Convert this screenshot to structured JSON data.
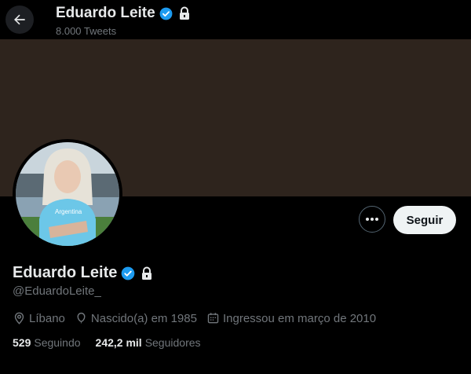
{
  "header": {
    "display_name": "Eduardo Leite",
    "tweet_count": "8.000 Tweets"
  },
  "profile": {
    "display_name": "Eduardo Leite",
    "handle": "@EduardoLeite_",
    "location": "Líbano",
    "birth": "Nascido(a) em 1985",
    "joined": "Ingressou em março de 2010",
    "following_count": "529",
    "following_label": "Seguindo",
    "followers_count": "242,2 mil",
    "followers_label": "Seguidores",
    "avatar_shirt_text": "Argentina"
  },
  "actions": {
    "follow_label": "Seguir"
  },
  "colors": {
    "background": "#000000",
    "banner": "#2e241d",
    "verified": "#1d9bf0",
    "primary_text": "#e7e9ea",
    "secondary_text": "#71767b",
    "follow_button_bg": "#eff3f4"
  },
  "icons": {
    "back": "arrow-left-icon",
    "verified": "verified-badge-icon",
    "protected": "lock-icon",
    "more": "more-dots-icon",
    "location": "location-pin-icon",
    "birth": "balloon-icon",
    "joined": "calendar-icon"
  }
}
